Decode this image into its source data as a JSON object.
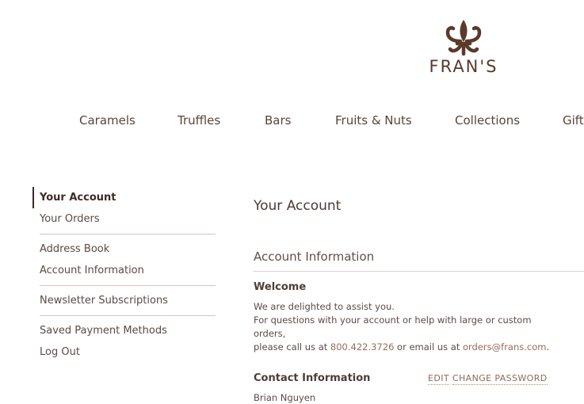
{
  "brand": {
    "name": "FRAN'S"
  },
  "nav": [
    {
      "label": "Caramels"
    },
    {
      "label": "Truffles"
    },
    {
      "label": "Bars"
    },
    {
      "label": "Fruits & Nuts"
    },
    {
      "label": "Collections"
    },
    {
      "label": "Gift"
    }
  ],
  "sidebar": {
    "items": [
      {
        "label": "Your Account"
      },
      {
        "label": "Your Orders"
      },
      {
        "label": "Address Book"
      },
      {
        "label": "Account Information"
      },
      {
        "label": "Newsletter Subscriptions"
      },
      {
        "label": "Saved Payment Methods"
      },
      {
        "label": "Log Out"
      }
    ]
  },
  "main": {
    "title": "Your Account",
    "section_title": "Account Information",
    "welcome": {
      "title": "Welcome",
      "line1": "We are delighted to assist you.",
      "line2": "For questions with your account or help with large or custom orders,",
      "line3_prefix": "please call us at ",
      "phone": "800.422.3726",
      "line3_mid": " or email us at ",
      "email": "orders@frans.com",
      "line3_suffix": "."
    },
    "contact": {
      "title": "Contact Information",
      "edit_label": "EDIT",
      "change_password_label": "CHANGE PASSWORD",
      "name": "Brian Nguyen"
    }
  },
  "colors": {
    "brand_brown": "#5b3a2a",
    "link": "#9a6c55",
    "text": "#4a3a33"
  }
}
